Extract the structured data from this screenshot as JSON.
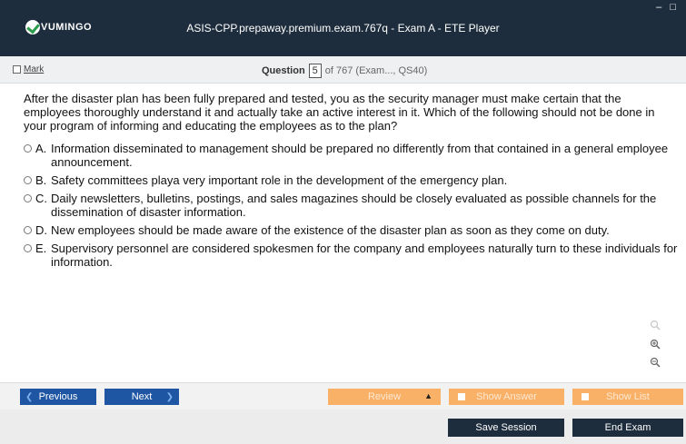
{
  "titlebar": {
    "logo_text": "VUMINGO",
    "title": "ASIS-CPP.prepaway.premium.exam.767q - Exam A - ETE Player",
    "controls": "– □"
  },
  "header": {
    "mark_label": "Mark",
    "question_label": "Question",
    "question_number": "5",
    "question_rest": "of 767 (Exam..., QS40)"
  },
  "question": {
    "text": "After the disaster plan has been fully prepared and tested, you as the security manager must make certain that the employees thoroughly understand it and actually take an active interest in it. Which of the following should not be done in your program of informing and educating the employees as to the plan?",
    "options": [
      {
        "key": "A.",
        "text": "Information disseminated to management should be prepared no differently from that contained in a general employee announcement."
      },
      {
        "key": "B.",
        "text": "Safety committees playa very important role in the development of the emergency plan."
      },
      {
        "key": "C.",
        "text": "Daily newsletters, bulletins, postings, and sales magazines should be closely evaluated as possible channels for the dissemination of disaster information."
      },
      {
        "key": "D.",
        "text": "New employees should be made aware of the existence of the disaster plan as soon as they come on duty."
      },
      {
        "key": "E.",
        "text": "Supervisory personnel are considered spokesmen for the company and employees naturally turn to these individuals for information."
      }
    ]
  },
  "nav": {
    "previous": "Previous",
    "next": "Next",
    "review": "Review",
    "show_answer": "Show Answer",
    "show_list": "Show List"
  },
  "footer": {
    "save_session": "Save Session",
    "end_exam": "End Exam"
  },
  "colors": {
    "titlebar": "#1e2d3d",
    "nav_blue": "#1f56a4",
    "nav_orange": "#f9b067"
  }
}
